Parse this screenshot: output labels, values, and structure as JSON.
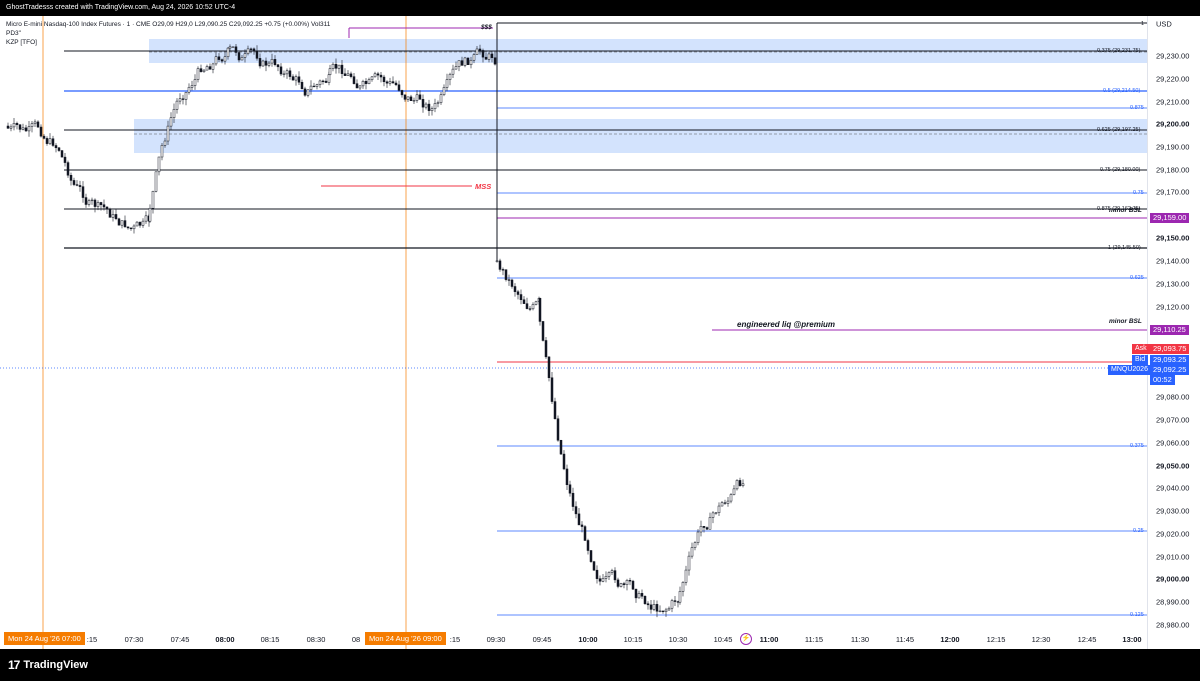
{
  "topbar": {
    "text": "GhostTradesss created with TradingView.com, Aug 24, 2026 10:52 UTC-4"
  },
  "header": {
    "line1": "Micro E-mini Nasdaq-100 Index Futures · 1 · CME  O29,09  H29,0  L29,090.25  C29,092.25  +0.75 (+0.00%)  Vol311",
    "line2": "PD3\"",
    "line3": "KZP [TFO]"
  },
  "currency": "USD",
  "price_axis": [
    {
      "label": "29,230.00",
      "bold": false
    },
    {
      "label": "29,220.00",
      "bold": false
    },
    {
      "label": "29,210.00",
      "bold": false
    },
    {
      "label": "29,200.00",
      "bold": true
    },
    {
      "label": "29,190.00",
      "bold": false
    },
    {
      "label": "29,180.00",
      "bold": false
    },
    {
      "label": "29,170.00",
      "bold": false
    },
    {
      "label": "29,150.00",
      "bold": true
    },
    {
      "label": "29,140.00",
      "bold": false
    },
    {
      "label": "29,130.00",
      "bold": false
    },
    {
      "label": "29,120.00",
      "bold": false
    },
    {
      "label": "29,080.00",
      "bold": false
    },
    {
      "label": "29,070.00",
      "bold": false
    },
    {
      "label": "29,060.00",
      "bold": false
    },
    {
      "label": "29,050.00",
      "bold": true
    },
    {
      "label": "29,040.00",
      "bold": false
    },
    {
      "label": "29,030.00",
      "bold": false
    },
    {
      "label": "29,020.00",
      "bold": false
    },
    {
      "label": "29,010.00",
      "bold": false
    },
    {
      "label": "29,000.00",
      "bold": true
    },
    {
      "label": "28,990.00",
      "bold": false
    },
    {
      "label": "28,980.00",
      "bold": false
    }
  ],
  "price_tags": {
    "bsl_top": "29,159.00",
    "bsl_low": "29,110.25",
    "ask_label": "Ask",
    "ask_value": "29,093.75",
    "bid_label": "Bid",
    "bid_value": "29,093.25",
    "symbol": "MNQU2026",
    "last": "29,092.25",
    "countdown": "00:52"
  },
  "levels": [
    {
      "label": "1",
      "color": "#131722"
    },
    {
      "label": "0.375 (29,231.75)",
      "color": "#131722"
    },
    {
      "label": "0.5 (29,214.50)",
      "color": "#2962ff"
    },
    {
      "label": "0.875",
      "color": "#2962ff"
    },
    {
      "label": "0.625 (29,197.25)",
      "color": "#131722"
    },
    {
      "label": "0.75 (29,180.00)",
      "color": "#131722"
    },
    {
      "label": "0.75",
      "color": "#2962ff"
    },
    {
      "label": "0.875 (29,162.75)",
      "color": "#131722"
    },
    {
      "label": "1 (29,145.50)",
      "color": "#131722"
    },
    {
      "label": "0.625",
      "color": "#2962ff"
    },
    {
      "label": "0.375",
      "color": "#2962ff"
    },
    {
      "label": "0.25",
      "color": "#2962ff"
    },
    {
      "label": "0.125",
      "color": "#2962ff"
    }
  ],
  "annotations": {
    "sss": "$$$",
    "mss": "MSS",
    "minor_bsl_1": "minor BSL",
    "minor_bsl_2": "minor BSL",
    "engineered": "engineered liq @premium"
  },
  "time_axis": [
    {
      "label": ":15",
      "bold": false
    },
    {
      "label": "07:30",
      "bold": false
    },
    {
      "label": "07:45",
      "bold": false
    },
    {
      "label": "08:00",
      "bold": true
    },
    {
      "label": "08:15",
      "bold": false
    },
    {
      "label": "08:30",
      "bold": false
    },
    {
      "label": "08",
      "bold": false
    },
    {
      "label": ":15",
      "bold": false
    },
    {
      "label": "09:30",
      "bold": false
    },
    {
      "label": "09:45",
      "bold": false
    },
    {
      "label": "10:00",
      "bold": true
    },
    {
      "label": "10:15",
      "bold": false
    },
    {
      "label": "10:30",
      "bold": false
    },
    {
      "label": "10:45",
      "bold": false
    },
    {
      "label": "11:00",
      "bold": true
    },
    {
      "label": "11:15",
      "bold": false
    },
    {
      "label": "11:30",
      "bold": false
    },
    {
      "label": "11:45",
      "bold": false
    },
    {
      "label": "12:00",
      "bold": true
    },
    {
      "label": "12:15",
      "bold": false
    },
    {
      "label": "12:30",
      "bold": false
    },
    {
      "label": "12:45",
      "bold": false
    },
    {
      "label": "13:00",
      "bold": true
    }
  ],
  "time_tags": {
    "left": "Mon 24 Aug '26   07:00",
    "mid": "Mon 24 Aug '26   09:00"
  },
  "footer": {
    "brand": "TradingView",
    "logo": "17"
  },
  "colors": {
    "up": "#131722",
    "zone": "#d3e3fd",
    "blue_line": "#2962ff",
    "red": "#f23645",
    "purple": "#9c27b0",
    "orange": "#f57c00",
    "bid": "#2962ff"
  }
}
